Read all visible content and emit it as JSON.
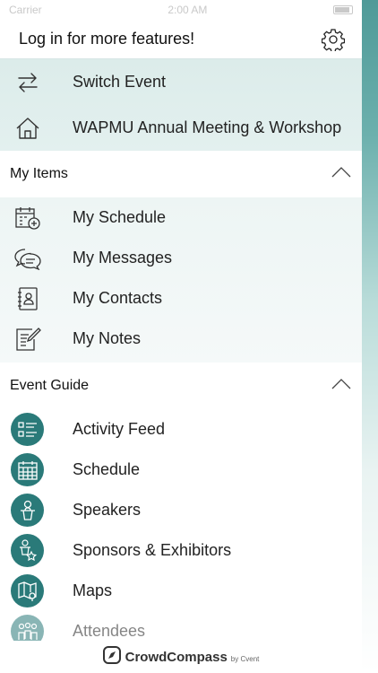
{
  "status_bar": {
    "carrier": "Carrier",
    "time": "2:00 AM"
  },
  "header": {
    "login_text": "Log in for more features!"
  },
  "event_nav": [
    {
      "label": "Switch Event",
      "icon": "switch-arrows-icon"
    },
    {
      "label": "WAPMU Annual Meeting & Workshop",
      "icon": "home-icon"
    }
  ],
  "my_items": {
    "title": "My Items",
    "items": [
      {
        "label": "My Schedule",
        "icon": "calendar-add-icon"
      },
      {
        "label": "My Messages",
        "icon": "chat-bubbles-icon"
      },
      {
        "label": "My Contacts",
        "icon": "address-book-icon"
      },
      {
        "label": "My Notes",
        "icon": "note-pencil-icon"
      }
    ]
  },
  "event_guide": {
    "title": "Event Guide",
    "items": [
      {
        "label": "Activity Feed",
        "icon": "list-icon"
      },
      {
        "label": "Schedule",
        "icon": "calendar-grid-icon"
      },
      {
        "label": "Speakers",
        "icon": "speaker-podium-icon"
      },
      {
        "label": "Sponsors & Exhibitors",
        "icon": "sponsor-star-icon"
      },
      {
        "label": "Maps",
        "icon": "map-pin-icon"
      },
      {
        "label": "Attendees",
        "icon": "people-icon"
      }
    ]
  },
  "footer": {
    "brand": "CrowdCompass",
    "by": "by Cvent"
  },
  "colors": {
    "accent": "#2a7a79",
    "event_bg": "#dcecea",
    "items_bg": "#edf5f4"
  }
}
